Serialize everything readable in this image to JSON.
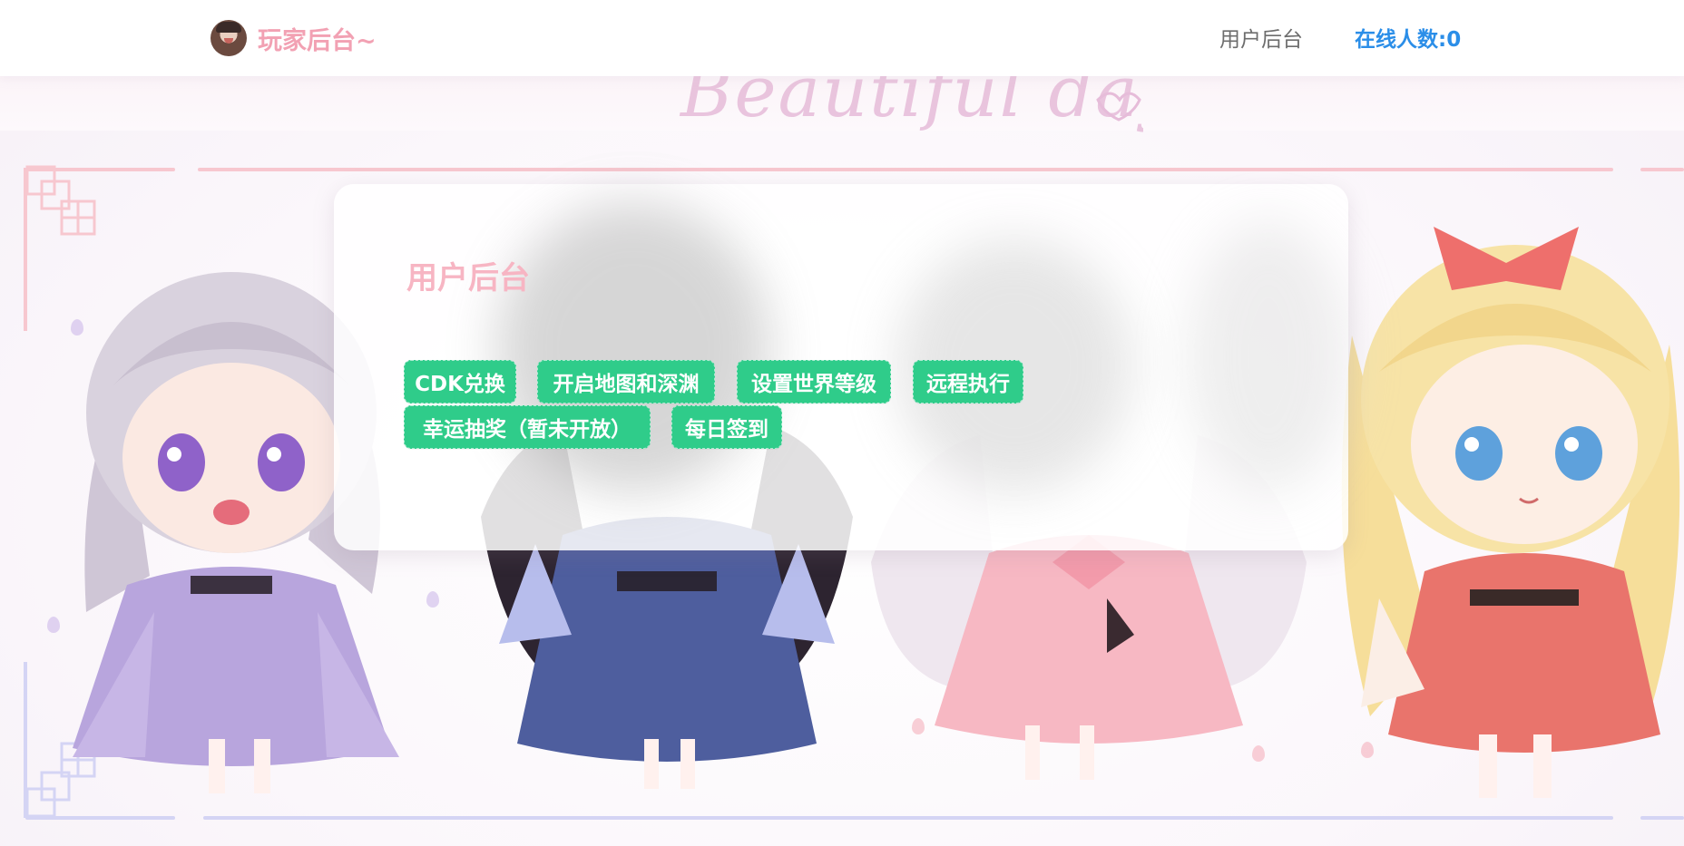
{
  "brand": {
    "title": "玩家后台~",
    "avatar_icon": "avatar-icon"
  },
  "nav": {
    "user_backend": "用户后台",
    "online_count": "在线人数:0"
  },
  "banner": {
    "script_text": "Beautiful days"
  },
  "panel": {
    "title": "用户后台",
    "buttons": [
      {
        "label": "CDK兑换"
      },
      {
        "label": "开启地图和深渊"
      },
      {
        "label": "设置世界等级"
      },
      {
        "label": "远程执行"
      },
      {
        "label": "幸运抽奖（暂未开放）"
      },
      {
        "label": "每日签到"
      }
    ]
  },
  "colors": {
    "brand_pink": "#f2a1b3",
    "title_pink": "#f7b5c3",
    "online_blue": "#2b8ee8",
    "button_green": "#2fcc8a"
  }
}
